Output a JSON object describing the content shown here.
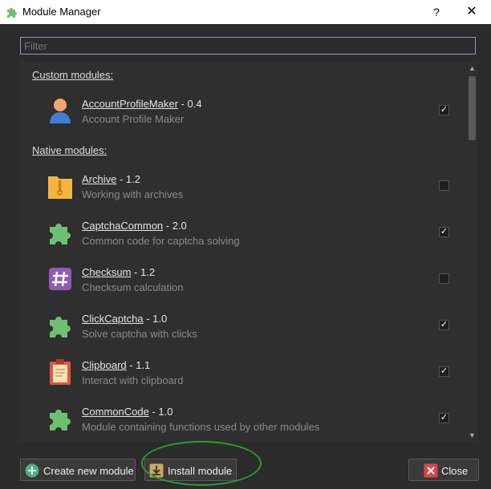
{
  "window": {
    "title": "Module Manager",
    "help_label": "?",
    "close_label": "✕"
  },
  "filter": {
    "placeholder": "Filter",
    "value": ""
  },
  "sections": {
    "custom": "Custom modules:",
    "native": "Native modules:"
  },
  "custom_modules": [
    {
      "name": "AccountProfileMaker",
      "version": "0.4",
      "description": "Account Profile Maker",
      "checked": true,
      "icon": "user-profile-icon"
    }
  ],
  "native_modules": [
    {
      "name": "Archive",
      "version": "1.2",
      "description": "Working with archives",
      "checked": false,
      "icon": "archive-zip-icon"
    },
    {
      "name": "CaptchaCommon",
      "version": "2.0",
      "description": "Common code for captcha solving",
      "checked": true,
      "icon": "puzzle-icon"
    },
    {
      "name": "Checksum",
      "version": "1.2",
      "description": "Checksum calculation",
      "checked": false,
      "icon": "hash-icon"
    },
    {
      "name": "ClickCaptcha",
      "version": "1.0",
      "description": "Solve captcha with clicks",
      "checked": true,
      "icon": "puzzle-icon"
    },
    {
      "name": "Clipboard",
      "version": "1.1",
      "description": "Interact with clipboard",
      "checked": true,
      "icon": "clipboard-icon"
    },
    {
      "name": "CommonCode",
      "version": "1.0",
      "description": "Module containing functions used by other modules",
      "checked": true,
      "icon": "puzzle-icon"
    }
  ],
  "separator": " - ",
  "check_glyph": "✓",
  "footer": {
    "create_label": "Create new module",
    "install_label": "Install module",
    "close_label": "Close"
  },
  "colors": {
    "accent_filter_border": "#a58bd8",
    "annotation_circle": "#28a028",
    "close_icon_bg": "#e04444",
    "install_icon_bg": "#c8a860",
    "create_icon_bg": "#4caf82"
  }
}
